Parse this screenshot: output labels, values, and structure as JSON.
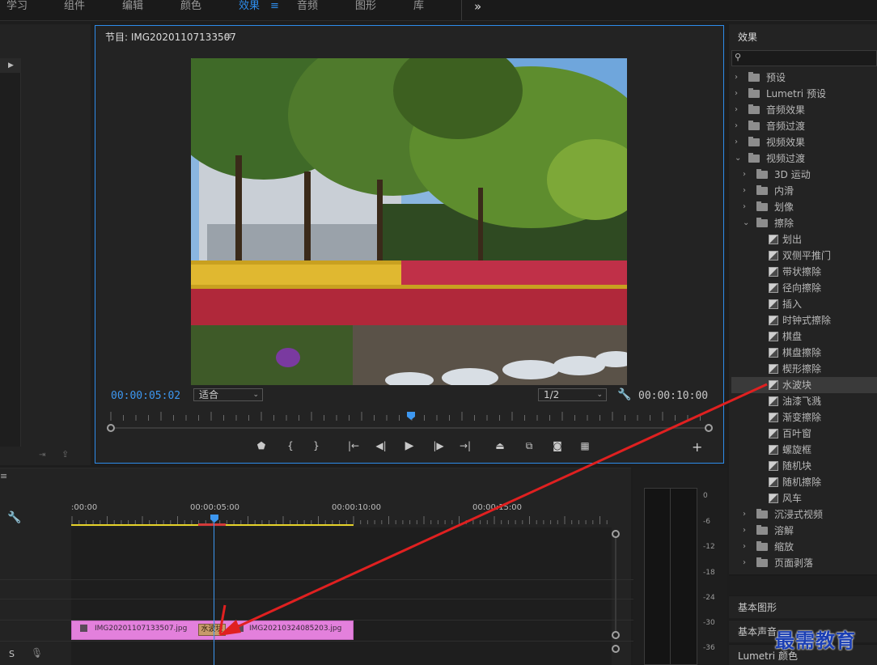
{
  "workspace": {
    "tabs": [
      "学习",
      "组件",
      "编辑",
      "颜色",
      "效果",
      "音频",
      "图形",
      "库"
    ],
    "active": "效果",
    "menu_icon": "hamburger-icon",
    "more_icon": "double-chevron-right-icon"
  },
  "program": {
    "title": "节目: IMG20201107133507",
    "timecode_current": "00:00:05:02",
    "fit_select": "适合",
    "resolution_select": "1/2",
    "timecode_duration": "00:00:10:00"
  },
  "effects": {
    "title": "效果",
    "search_placeholder": "",
    "items": [
      {
        "label": "预设",
        "type": "folder-star",
        "level": 0,
        "open": false
      },
      {
        "label": "Lumetri 预设",
        "type": "folder-star",
        "level": 0,
        "open": false
      },
      {
        "label": "音频效果",
        "type": "folder",
        "level": 0,
        "open": false
      },
      {
        "label": "音频过渡",
        "type": "folder",
        "level": 0,
        "open": false
      },
      {
        "label": "视频效果",
        "type": "folder",
        "level": 0,
        "open": false
      },
      {
        "label": "视频过渡",
        "type": "folder",
        "level": 0,
        "open": true
      },
      {
        "label": "3D 运动",
        "type": "folder",
        "level": 1,
        "open": false
      },
      {
        "label": "内滑",
        "type": "folder",
        "level": 1,
        "open": false
      },
      {
        "label": "划像",
        "type": "folder",
        "level": 1,
        "open": false
      },
      {
        "label": "擦除",
        "type": "folder",
        "level": 1,
        "open": true
      },
      {
        "label": "划出",
        "type": "effect",
        "level": 2
      },
      {
        "label": "双侧平推门",
        "type": "effect",
        "level": 2
      },
      {
        "label": "带状擦除",
        "type": "effect",
        "level": 2
      },
      {
        "label": "径向擦除",
        "type": "effect",
        "level": 2
      },
      {
        "label": "插入",
        "type": "effect",
        "level": 2
      },
      {
        "label": "时钟式擦除",
        "type": "effect",
        "level": 2
      },
      {
        "label": "棋盘",
        "type": "effect",
        "level": 2
      },
      {
        "label": "棋盘擦除",
        "type": "effect",
        "level": 2
      },
      {
        "label": "楔形擦除",
        "type": "effect",
        "level": 2
      },
      {
        "label": "水波块",
        "type": "effect",
        "level": 2,
        "selected": true
      },
      {
        "label": "油漆飞溅",
        "type": "effect",
        "level": 2
      },
      {
        "label": "渐变擦除",
        "type": "effect",
        "level": 2
      },
      {
        "label": "百叶窗",
        "type": "effect",
        "level": 2
      },
      {
        "label": "螺旋框",
        "type": "effect",
        "level": 2
      },
      {
        "label": "随机块",
        "type": "effect",
        "level": 2
      },
      {
        "label": "随机擦除",
        "type": "effect",
        "level": 2
      },
      {
        "label": "风车",
        "type": "effect",
        "level": 2
      },
      {
        "label": "沉浸式视频",
        "type": "folder",
        "level": 1,
        "open": false
      },
      {
        "label": "溶解",
        "type": "folder",
        "level": 1,
        "open": false
      },
      {
        "label": "缩放",
        "type": "folder",
        "level": 1,
        "open": false
      },
      {
        "label": "页面剥落",
        "type": "folder",
        "level": 1,
        "open": false
      }
    ]
  },
  "panels": {
    "essential_graphics": "基本图形",
    "essential_sound": "基本声音",
    "lumetri_color": "Lumetri 颜色"
  },
  "timeline": {
    "timecodes": [
      ":00:00",
      "00:00:05:00",
      "00:00:10:00",
      "00:00:15:00"
    ],
    "clip_a": "IMG20201107133507.jpg",
    "clip_b": "IMG20210324085203.jpg",
    "transition": "水波块",
    "track_label": "S"
  },
  "meter": {
    "scale": [
      "0",
      "-6",
      "-12",
      "-18",
      "-24",
      "-30",
      "-36"
    ]
  },
  "watermark": "最需教育",
  "colors": {
    "accent": "#2d8ceb",
    "clip": "#e380dc",
    "work_area": "#e6d22a",
    "arrow": "#e02020"
  }
}
